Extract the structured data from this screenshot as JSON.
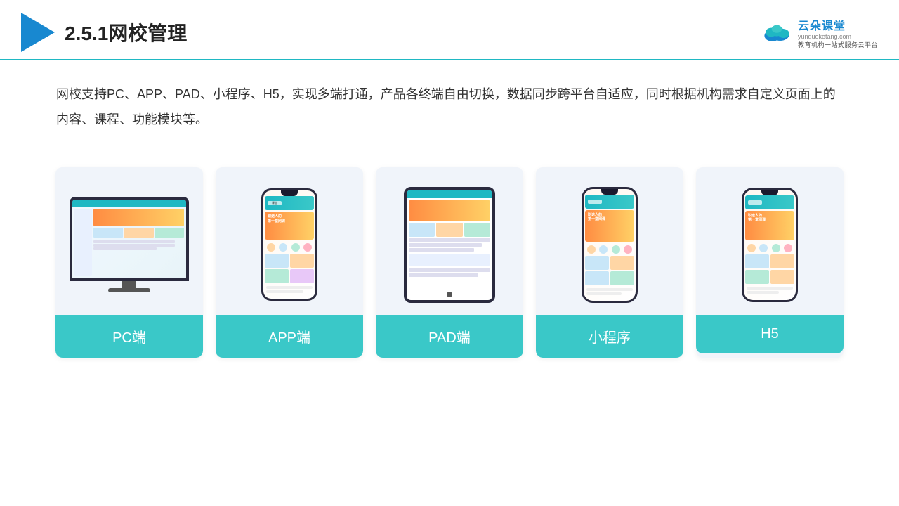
{
  "header": {
    "title": "2.5.1网校管理",
    "logo_main": "云朵课堂",
    "logo_sub": "教育机构一站\n式服务云平台",
    "logo_domain": "yunduoketang.com"
  },
  "description": {
    "text": "网校支持PC、APP、PAD、小程序、H5，实现多端打通，产品各终端自由切换，数据同步跨平台自适应，同时根据机构需求自定义页面上的内容、课程、功能模块等。"
  },
  "cards": [
    {
      "id": "pc",
      "label": "PC端"
    },
    {
      "id": "app",
      "label": "APP端"
    },
    {
      "id": "pad",
      "label": "PAD端"
    },
    {
      "id": "miniprogram",
      "label": "小程序"
    },
    {
      "id": "h5",
      "label": "H5"
    }
  ],
  "accent_color": "#3ac8c8"
}
